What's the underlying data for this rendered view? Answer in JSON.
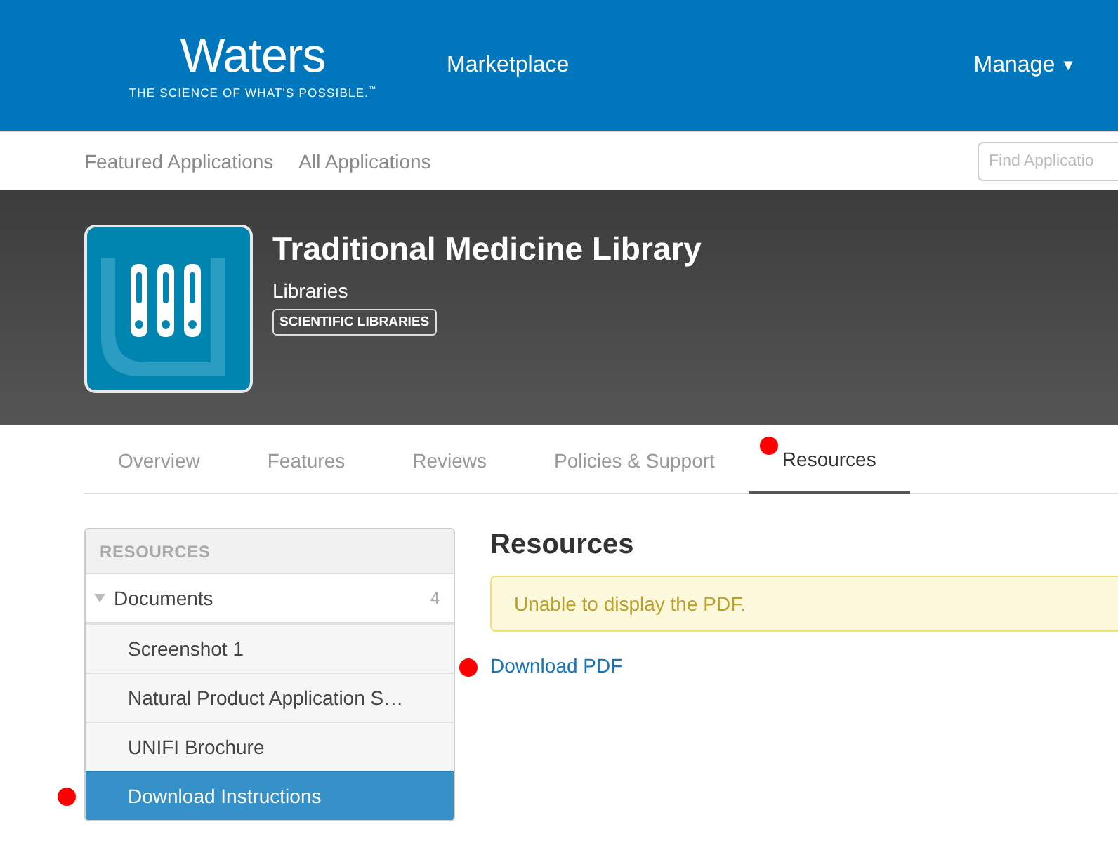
{
  "header": {
    "logo": {
      "name": "Waters",
      "tagline": "THE SCIENCE OF WHAT'S POSSIBLE.$^{™}$"
    },
    "title": "Marketplace",
    "menu": {
      "label": "Manage",
      "caret": "▼"
    }
  },
  "subnav": {
    "links": [
      "Featured Applications",
      "All Applications"
    ],
    "search": {
      "placeholder": "Find Applicatio"
    }
  },
  "app": {
    "title": "Traditional Medicine Library",
    "category": "Libraries",
    "tag": "SCIENTIFIC LIBRARIES"
  },
  "tabs": [
    {
      "label": "Overview",
      "selected": false
    },
    {
      "label": "Features",
      "selected": false
    },
    {
      "label": "Reviews",
      "selected": false
    },
    {
      "label": "Policies & Support",
      "selected": false
    },
    {
      "label": "Resources",
      "selected": true
    }
  ],
  "sidebar": {
    "heading": "RESOURCES",
    "group": {
      "label": "Documents",
      "count": "4",
      "expanded": true,
      "items": [
        {
          "label": "Screenshot 1",
          "selected": false
        },
        {
          "label": "Natural Product Application S…",
          "selected": false
        },
        {
          "label": "UNIFI Brochure",
          "selected": false
        },
        {
          "label": "Download Instructions",
          "selected": true
        }
      ]
    }
  },
  "main": {
    "heading": "Resources",
    "alert": "Unable to display the PDF.",
    "link": "Download PDF"
  }
}
